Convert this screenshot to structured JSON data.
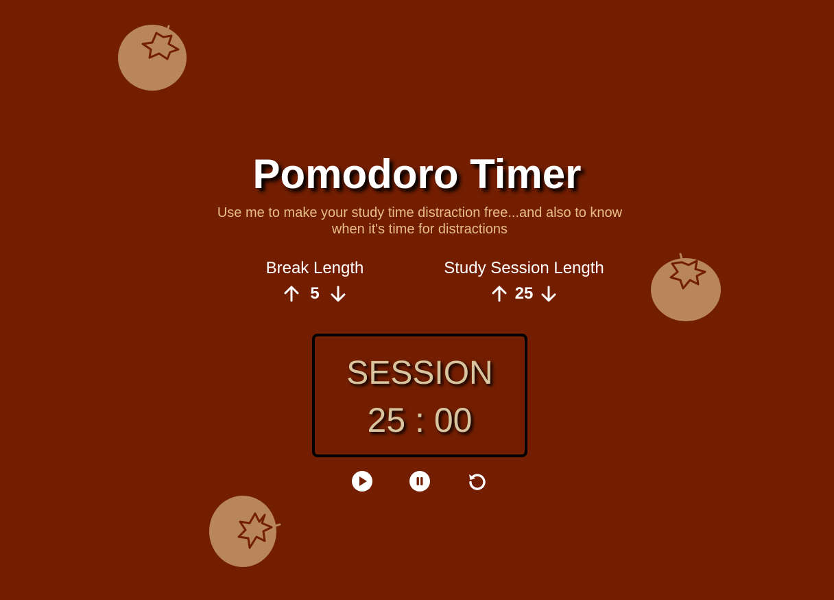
{
  "app": {
    "title": "Pomodoro Timer",
    "subtitle": "Use me to make your study time distraction free...and also to know when it's time for distractions"
  },
  "break": {
    "label": "Break Length",
    "value": "5",
    "increment_icon": "arrow-up-icon",
    "decrement_icon": "arrow-down-icon"
  },
  "session": {
    "label": "Study Session Length",
    "value": "25",
    "increment_icon": "arrow-up-icon",
    "decrement_icon": "arrow-down-icon"
  },
  "timer": {
    "label": "SESSION",
    "time": "25 : 00"
  },
  "controls": [
    {
      "name": "play",
      "icon": "play-icon"
    },
    {
      "name": "pause",
      "icon": "pause-icon"
    },
    {
      "name": "reset",
      "icon": "reset-icon"
    }
  ],
  "decorations": [
    {
      "name": "tomato",
      "icon": "tomato-icon"
    }
  ],
  "colors": {
    "background": "#731e00",
    "tomato": "#b8855c",
    "subtitle": "#e7bd87",
    "timer_text": "#d8c49e",
    "text": "#ffffff"
  }
}
